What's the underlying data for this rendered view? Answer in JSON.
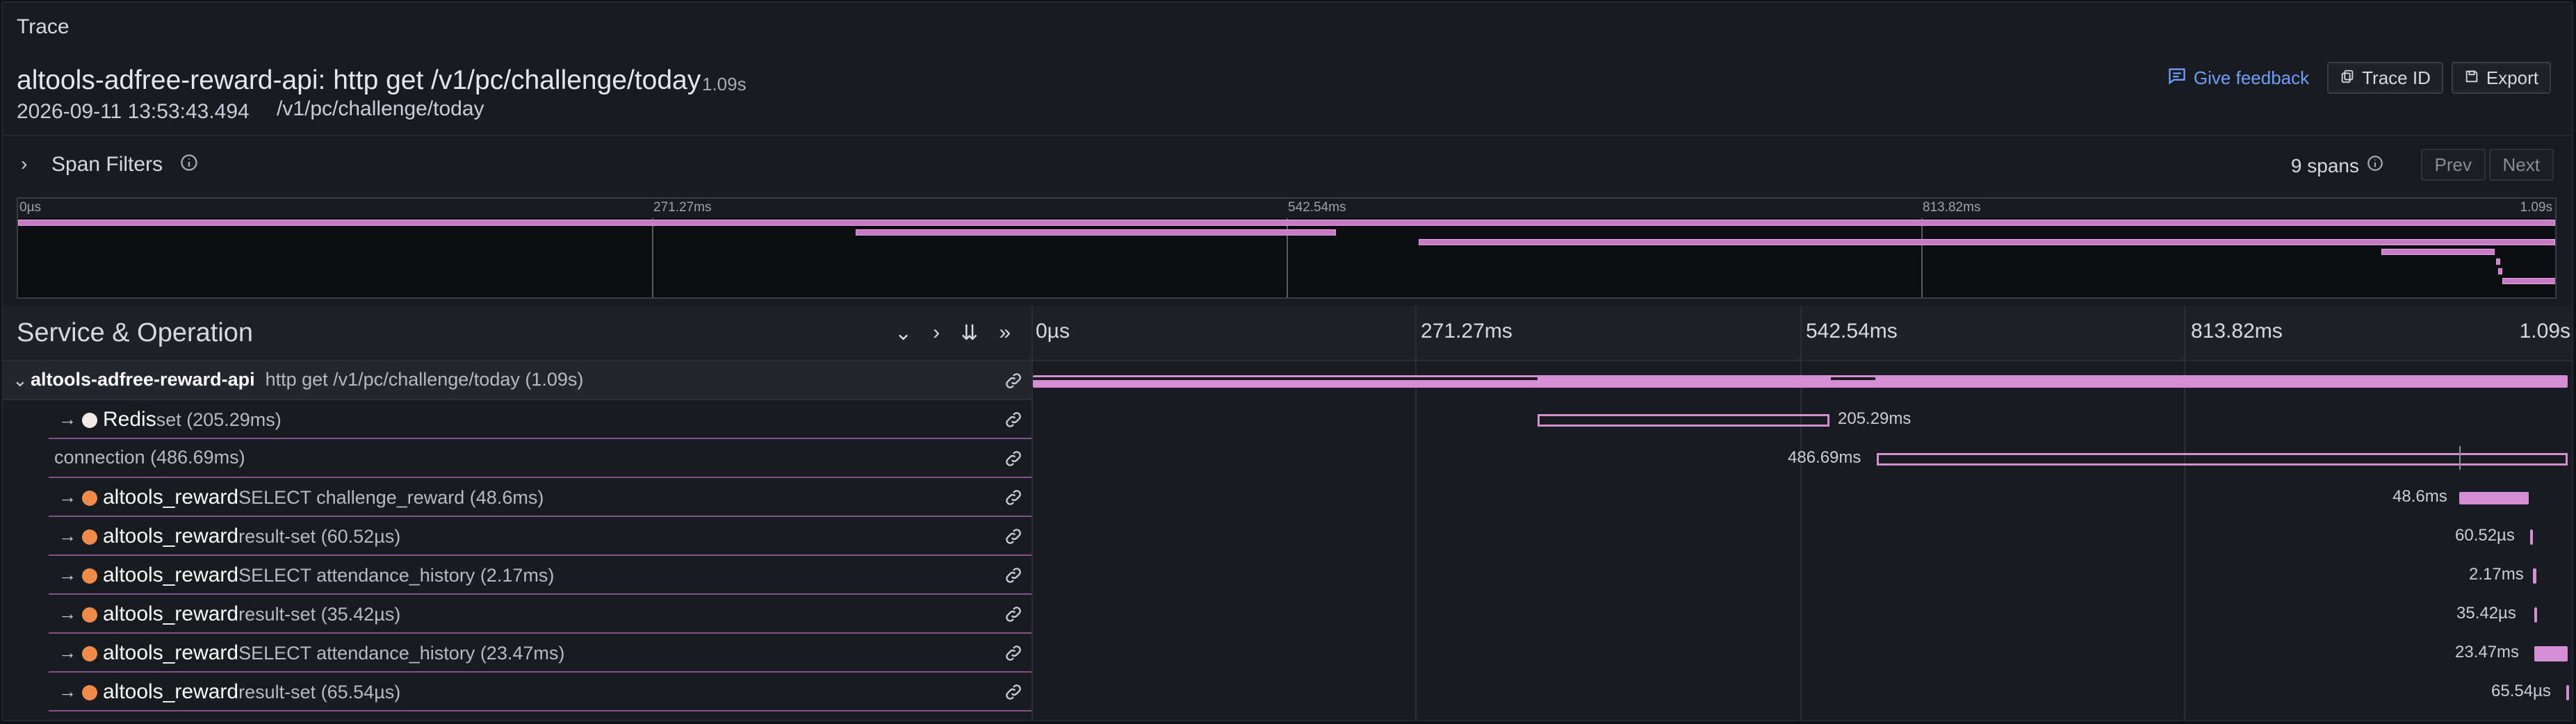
{
  "panel": {
    "title": "Trace"
  },
  "header": {
    "title": "altools-adfree-reward-api: http get /v1/pc/challenge/today",
    "duration": "1.09s",
    "date": "2026-09-11 13:53:43.494",
    "url": "/v1/pc/challenge/today",
    "feedback_label": "Give feedback",
    "trace_id_label": "Trace ID",
    "export_label": "Export"
  },
  "filters": {
    "label": "Span Filters",
    "span_count": "9 spans",
    "prev_label": "Prev",
    "next_label": "Next"
  },
  "minimap": {
    "ticks": [
      "0µs",
      "271.27ms",
      "542.54ms",
      "813.82ms",
      "1.09s"
    ]
  },
  "table": {
    "header_title": "Service & Operation",
    "timeline_ticks": [
      "0µs",
      "271.27ms",
      "542.54ms",
      "813.82ms",
      "1.09s"
    ],
    "rows": [
      {
        "service": "altools-adfree-reward-api",
        "operation": "http get /v1/pc/challenge/today (1.09s)",
        "bar_label": ""
      },
      {
        "service": "Redis",
        "operation": "set (205.29ms)",
        "bar_label": "205.29ms"
      },
      {
        "service": "",
        "operation": "connection (486.69ms)",
        "bar_label": "486.69ms"
      },
      {
        "service": "altools_reward",
        "operation": "SELECT challenge_reward (48.6ms)",
        "bar_label": "48.6ms"
      },
      {
        "service": "altools_reward",
        "operation": "result-set (60.52µs)",
        "bar_label": "60.52µs"
      },
      {
        "service": "altools_reward",
        "operation": "SELECT attendance_history (2.17ms)",
        "bar_label": "2.17ms"
      },
      {
        "service": "altools_reward",
        "operation": "result-set (35.42µs)",
        "bar_label": "35.42µs"
      },
      {
        "service": "altools_reward",
        "operation": "SELECT attendance_history (23.47ms)",
        "bar_label": "23.47ms"
      },
      {
        "service": "altools_reward",
        "operation": "result-set (65.54µs)",
        "bar_label": "65.54µs"
      }
    ]
  },
  "colors": {
    "accent": "#6e9fff",
    "span_bar": "#d58dd3",
    "redis_dot": "#f5ebe6",
    "db_dot": "#f08c4b"
  },
  "icons": [
    "feedback-icon",
    "copy-icon",
    "save-icon",
    "chevron-right-icon",
    "info-icon",
    "link-icon",
    "arrow-right-icon",
    "chevron-down-icon"
  ]
}
